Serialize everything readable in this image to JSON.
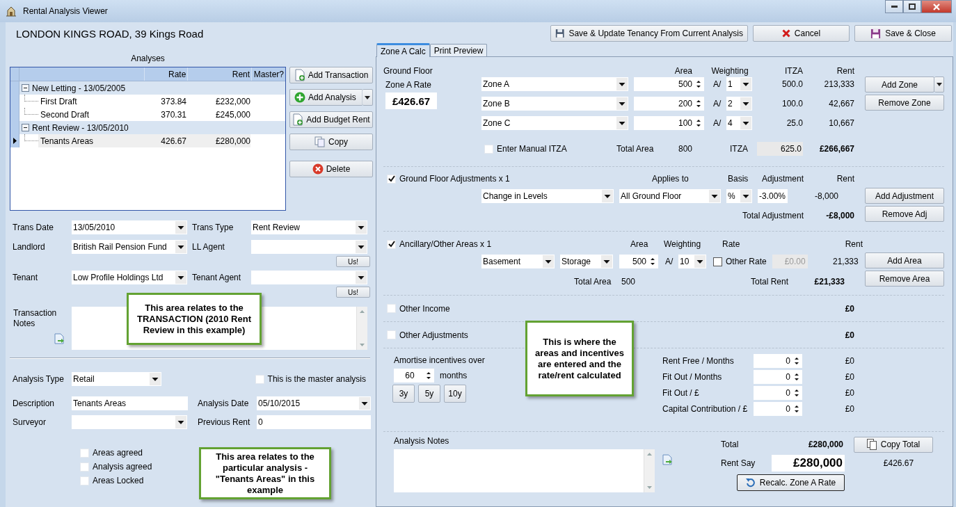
{
  "window": {
    "title": "Rental Analysis Viewer"
  },
  "header": {
    "property": "LONDON KINGS ROAD, 39 Kings Road",
    "buttons": [
      {
        "label": "Save & Update Tenancy From Current Analysis",
        "kind": "save-update"
      },
      {
        "label": "Cancel",
        "kind": "cancel"
      },
      {
        "label": "Save & Close",
        "kind": "save"
      }
    ]
  },
  "analyses": {
    "title": "Analyses",
    "columns": [
      "Rate",
      "Rent",
      "Master?"
    ],
    "groups": [
      {
        "label": "New Letting - 13/05/2005",
        "expanded": true,
        "children": [
          {
            "name": "First Draft",
            "rate": "373.84",
            "rent": "£232,000",
            "selected": false
          },
          {
            "name": "Second Draft",
            "rate": "370.31",
            "rent": "£245,000",
            "selected": false
          }
        ]
      },
      {
        "label": "Rent Review - 13/05/2010",
        "expanded": true,
        "children": [
          {
            "name": "Tenants Areas",
            "rate": "426.67",
            "rent": "£280,000",
            "selected": true
          }
        ]
      }
    ],
    "buttons": [
      {
        "label": "Add Transaction",
        "kind": "doc-add",
        "dropdown": false
      },
      {
        "label": "Add Analysis",
        "kind": "plus",
        "dropdown": true
      },
      {
        "label": "Add Budget Rent",
        "kind": "doc-add",
        "dropdown": false
      },
      {
        "label": "Copy",
        "kind": "copy",
        "dropdown": false
      },
      {
        "label": "Delete",
        "kind": "delete",
        "dropdown": false
      }
    ]
  },
  "transaction": {
    "rows": [
      {
        "label": "Trans Date",
        "value": "13/05/2010",
        "label2": "Trans Type",
        "value2": "Rent Review"
      },
      {
        "label": "Landlord",
        "value": "British Rail Pension Fund",
        "label2": "LL Agent",
        "us": "Us!"
      },
      {
        "label": "Tenant",
        "value": "Low Profile Holdings Ltd",
        "label2": "Tenant Agent",
        "us": "Us!"
      }
    ],
    "notes_label": "Transaction Notes"
  },
  "analysis": {
    "type": {
      "label": "Analysis Type",
      "value": "Retail"
    },
    "master": {
      "label": "This is the master analysis",
      "checked": false
    },
    "description": {
      "label": "Description",
      "value": "Tenants Areas"
    },
    "date": {
      "label": "Analysis Date",
      "value": "05/10/2015"
    },
    "surveyor": {
      "label": "Surveyor"
    },
    "previous_rent": {
      "label": "Previous Rent",
      "value": "0"
    },
    "checkboxes": [
      {
        "label": "Areas agreed",
        "checked": false
      },
      {
        "label": "Analysis agreed",
        "checked": false
      },
      {
        "label": "Areas Locked",
        "checked": false
      }
    ]
  },
  "tabs": [
    {
      "label": "Zone A Calc",
      "selected": true
    },
    {
      "label": "Print Preview",
      "selected": false
    }
  ],
  "ground_floor": {
    "title": "Ground Floor",
    "rate_label": "Zone A Rate",
    "rate": "£426.67",
    "columns": [
      "Area",
      "Weighting",
      "ITZA",
      "Rent"
    ],
    "zones": [
      {
        "name": "Zone A",
        "area": "500",
        "prefix": "A/",
        "weighting": "1",
        "itza": "500.0",
        "rent": "213,333"
      },
      {
        "name": "Zone B",
        "area": "200",
        "prefix": "A/",
        "weighting": "2",
        "itza": "100.0",
        "rent": "42,667"
      },
      {
        "name": "Zone C",
        "area": "100",
        "prefix": "A/",
        "weighting": "4",
        "itza": "25.0",
        "rent": "10,667"
      }
    ],
    "buttons": [
      "Add Zone",
      "Remove Zone"
    ],
    "manual_itza": {
      "label": "Enter Manual ITZA",
      "checked": false
    },
    "total_area_label": "Total Area",
    "total_area": "800",
    "itza_label": "ITZA",
    "itza": "625.0",
    "total_rent": "£266,667"
  },
  "adjustments": {
    "label": "Ground Floor Adjustments x 1",
    "checked": true,
    "columns": [
      "Applies to",
      "Basis",
      "Adjustment",
      "Rent"
    ],
    "rows": [
      {
        "type": "Change in Levels",
        "applies_to": "All Ground Floor",
        "basis": "%",
        "adjustment": "-3.00%",
        "rent": "-8,000"
      }
    ],
    "total_label": "Total Adjustment",
    "total": "-£8,000",
    "buttons": [
      "Add Adjustment",
      "Remove Adj"
    ]
  },
  "ancillary": {
    "label": "Ancillary/Other Areas x 1",
    "checked": true,
    "columns": [
      "Area",
      "Weighting",
      "Rate",
      "Rent"
    ],
    "rows": [
      {
        "type": "Basement",
        "use": "Storage",
        "area": "500",
        "prefix": "A/",
        "weighting": "10",
        "other_rate": {
          "label": "Other Rate",
          "checked": false
        },
        "rate": "£0.00",
        "rent": "21,333"
      }
    ],
    "total_area_label": "Total Area",
    "total_area": "500",
    "total_rent_label": "Total Rent",
    "total_rent": "£21,333",
    "buttons": [
      "Add Area",
      "Remove Area"
    ]
  },
  "other_income": {
    "label": "Other Income",
    "checked": false,
    "total": "£0"
  },
  "other_adjustments": {
    "label": "Other Adjustments",
    "checked": false,
    "total": "£0"
  },
  "incentives": {
    "amortise_label": "Amortise incentives over",
    "months": "60",
    "months_label": "months",
    "presets": [
      "3y",
      "5y",
      "10y"
    ],
    "items": [
      {
        "label": "Rent Free / Months",
        "value": "0",
        "amount": "£0"
      },
      {
        "label": "Fit Out / Months",
        "value": "0",
        "amount": "£0"
      },
      {
        "label": "Fit Out / £",
        "value": "0",
        "amount": "£0"
      },
      {
        "label": "Capital Contribution / £",
        "value": "0",
        "amount": "£0"
      }
    ]
  },
  "summary": {
    "notes_label": "Analysis Notes",
    "total_label": "Total",
    "total": "£280,000",
    "copy_button": "Copy Total",
    "rent_say_label": "Rent Say",
    "rent_say": "£280,000",
    "rate": "£426.67",
    "recalc_button": "Recalc. Zone A Rate"
  },
  "callouts": [
    {
      "text": "This area relates to the TRANSACTION (2010 Rent Review in this example)"
    },
    {
      "text": "This area relates to the particular analysis - \"Tenants Areas\" in this example"
    },
    {
      "text": "This is where the areas and incentives are entered and the rate/rent calculated"
    }
  ]
}
